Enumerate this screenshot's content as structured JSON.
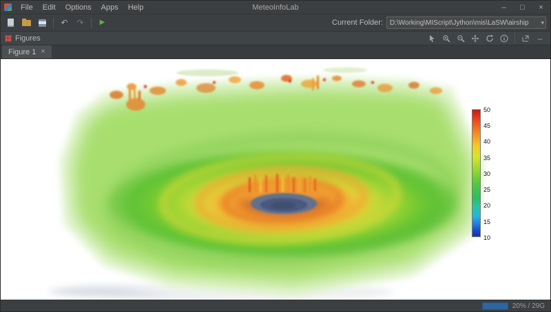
{
  "window": {
    "title": "MeteoInfoLab",
    "minimize": "–",
    "maximize": "□",
    "close": "×"
  },
  "menu": {
    "items": [
      "File",
      "Edit",
      "Options",
      "Apps",
      "Help"
    ]
  },
  "toolbar": {
    "undo_glyph": "↶",
    "redo_glyph": "↷",
    "run_glyph": "▶",
    "current_folder_label": "Current Folder:",
    "current_folder_path": "D:\\Working\\MIScript\\Jython\\mis\\LaSW\\airship",
    "combo_arrow": "▾"
  },
  "figures": {
    "panel_title": "Figures",
    "tab_label": "Figure 1",
    "tab_close": "×",
    "hide_glyph": "–"
  },
  "chart_data": {
    "type": "heatmap",
    "description": "3D volume rendering of a typhoon wind field viewed at an angle; green outer field, yellow-orange spiral bands, orange convective eyewall towers and a dark central eye",
    "colorbar": {
      "min": 10,
      "max": 50,
      "ticks": [
        50,
        45,
        40,
        35,
        30,
        25,
        20,
        15,
        10
      ],
      "colors_top_to_bottom": [
        "#c21c16",
        "#f0681f",
        "#f59d24",
        "#f2ce27",
        "#a4dc30",
        "#3ec44c",
        "#28c4a8",
        "#2277dd",
        "#1430b0"
      ]
    }
  },
  "statusbar": {
    "memory": "20% / 29G"
  }
}
